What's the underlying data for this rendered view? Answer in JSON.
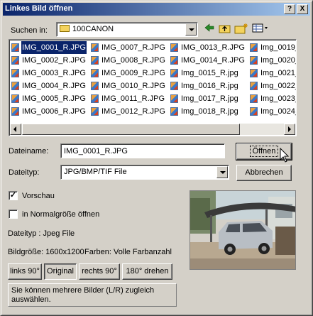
{
  "window": {
    "title": "Linkes Bild öffnen"
  },
  "titlebar_buttons": {
    "help": "?",
    "close": "X"
  },
  "lookin": {
    "label": "Suchen in:",
    "value": "100CANON"
  },
  "files": {
    "columns": [
      [
        "IMG_0001_R.JPG",
        "IMG_0002_R.JPG",
        "IMG_0003_R.JPG",
        "IMG_0004_R.JPG",
        "IMG_0005_R.JPG",
        "IMG_0006_R.JPG"
      ],
      [
        "IMG_0007_R.JPG",
        "IMG_0008_R.JPG",
        "IMG_0009_R.JPG",
        "IMG_0010_R.JPG",
        "IMG_0011_R.JPG",
        "IMG_0012_R.JPG"
      ],
      [
        "IMG_0013_R.JPG",
        "IMG_0014_R.JPG",
        "Img_0015_R.jpg",
        "Img_0016_R.jpg",
        "Img_0017_R.jpg",
        "Img_0018_R.jpg"
      ],
      [
        "Img_0019_",
        "Img_0020_",
        "Img_0021_",
        "Img_0022_",
        "Img_0023_",
        "Img_0024_"
      ]
    ],
    "selected": "IMG_0001_R.JPG"
  },
  "filename": {
    "label": "Dateiname:",
    "value": "IMG_0001_R.JPG"
  },
  "filetype": {
    "label": "Dateityp:",
    "value": "JPG/BMP/TIF File"
  },
  "buttons": {
    "open": "Öffnen",
    "cancel": "Abbrechen"
  },
  "preview_check": {
    "label": "Vorschau",
    "checked": true
  },
  "fullsize_check": {
    "label": "in Normalgröße öffnen",
    "checked": false
  },
  "info": {
    "filetype": "Dateityp : Jpeg File",
    "imagesize": "Bildgröße: 1600x1200",
    "colors": "Farben: Volle Farbanzahl"
  },
  "rotate": {
    "left": "links 90°",
    "original": "Original",
    "right": "rechts 90°",
    "r180": "180° drehen"
  },
  "hint": "Sie können mehrere Bilder (L/R) zugleich auswählen.",
  "colors": {
    "titlebar_start": "#0a246a",
    "titlebar_end": "#a6caf0",
    "selection": "#0a246a"
  }
}
